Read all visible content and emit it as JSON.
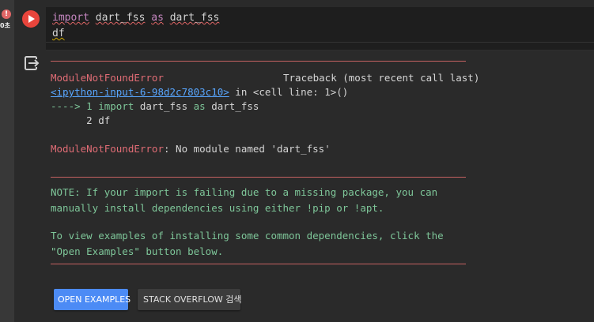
{
  "cell": {
    "error_badge": "!",
    "exec_time": "0초",
    "code": {
      "line1": {
        "kw_import": "import",
        "module": "dart_fss",
        "kw_as": "as",
        "alias": "dart_fss"
      },
      "line2": "df"
    }
  },
  "output": {
    "icon": "output-exit-icon",
    "separator": "------------------------------------------------------------------------------------",
    "error_name": "ModuleNotFoundError",
    "traceback_label": "Traceback (most recent call last)",
    "input_link": "<ipython-input-6-98d2c7803c10>",
    "in_cell": " in <cell line: 1>()",
    "arrow_line": {
      "arrow": "----> 1 ",
      "kw_import": "import",
      "module": " dart_fss ",
      "kw_as": "as",
      "alias": " dart_fss"
    },
    "line2": "      2 df",
    "final_error": {
      "name": "ModuleNotFoundError",
      "message": ": No module named 'dart_fss'"
    },
    "note_lines": [
      "NOTE: If your import is failing due to a missing package, you can",
      "manually install dependencies using either !pip or !apt.",
      "",
      "To view examples of installing some common dependencies, click the",
      "\"Open Examples\" button below."
    ]
  },
  "buttons": {
    "open_examples": "OPEN EXAMPLES",
    "stack_overflow": "STACK OVERFLOW 검색"
  },
  "colors": {
    "error_red": "#e06c75",
    "note_green": "#7ec699",
    "link_blue": "#58a6ff",
    "primary_button": "#4c8bf5",
    "run_button": "#e8453c"
  }
}
